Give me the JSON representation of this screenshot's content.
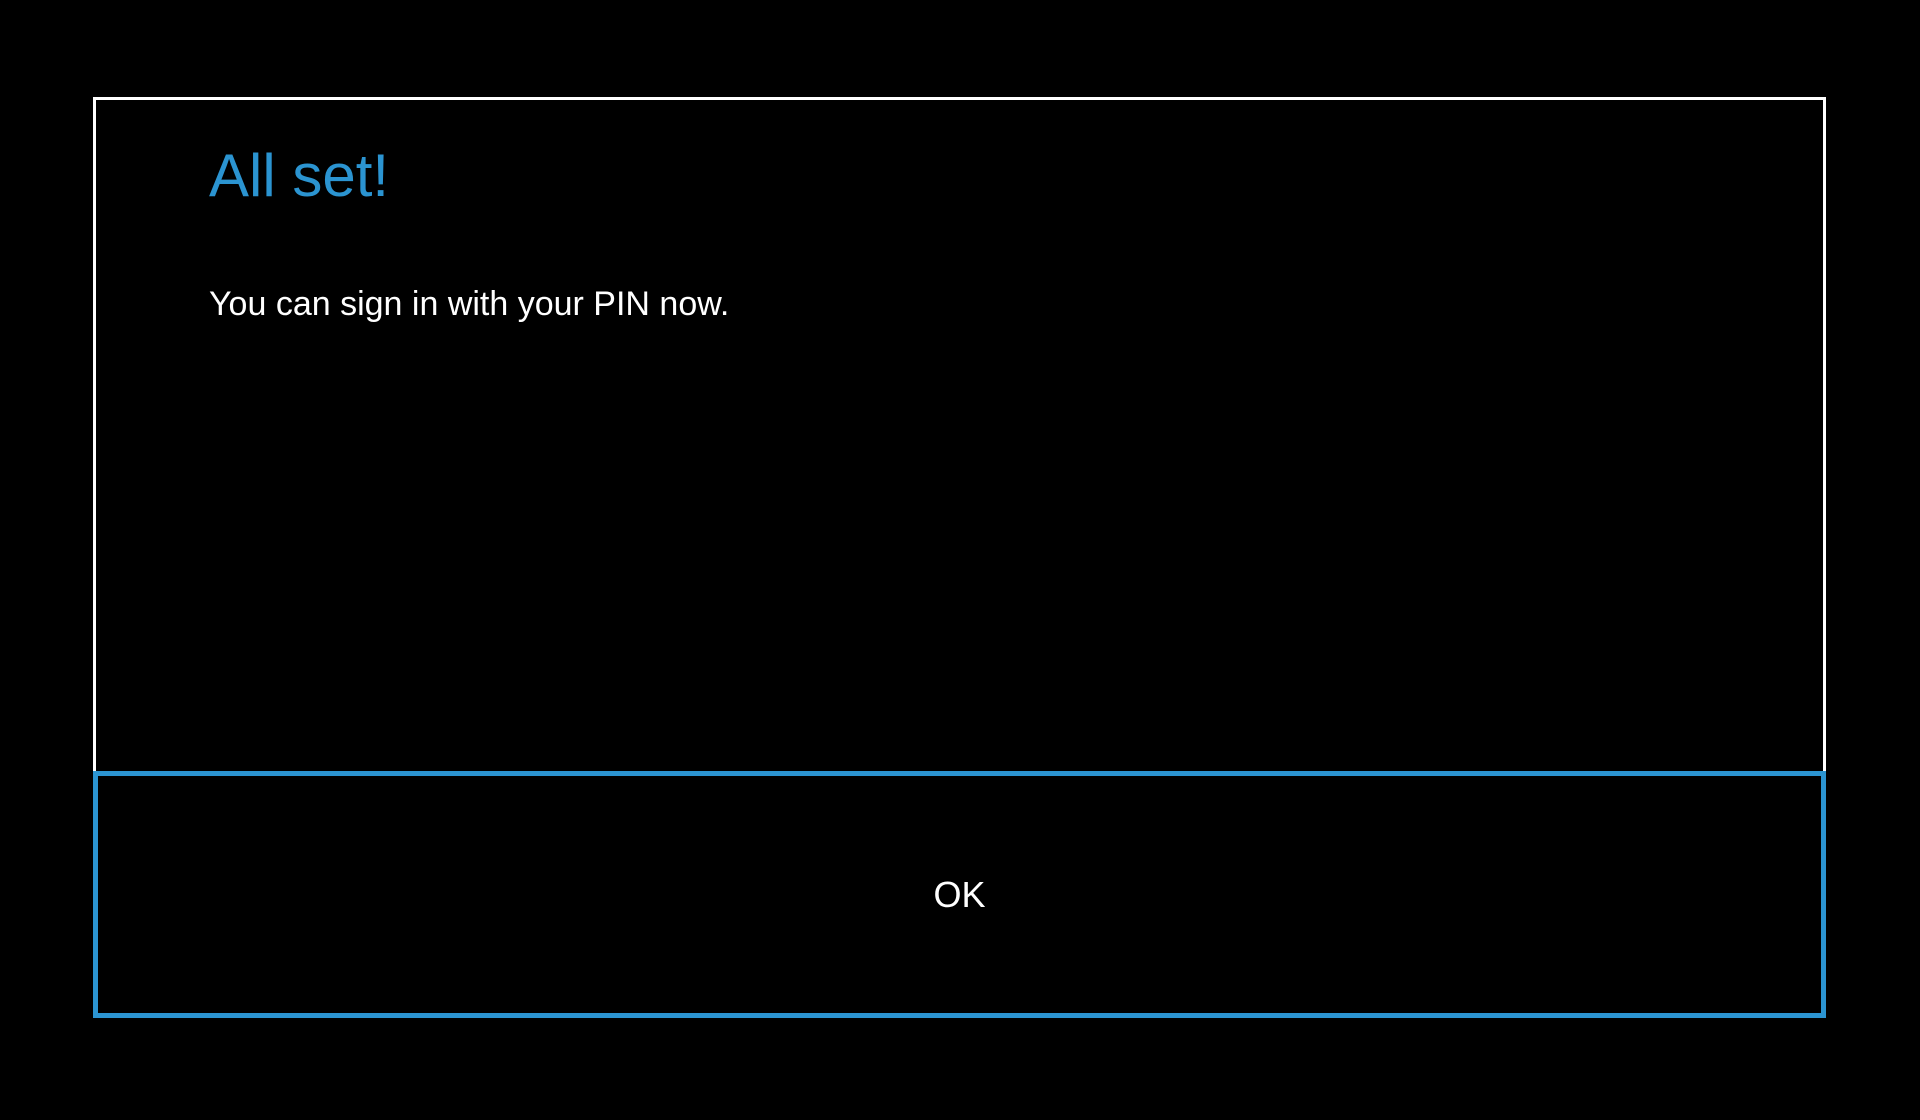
{
  "dialog": {
    "title": "All set!",
    "message": "You can sign in with your PIN now.",
    "ok_label": "OK"
  },
  "colors": {
    "background": "#000000",
    "accent": "#2b94d1",
    "text": "#ffffff",
    "border": "#ffffff"
  }
}
